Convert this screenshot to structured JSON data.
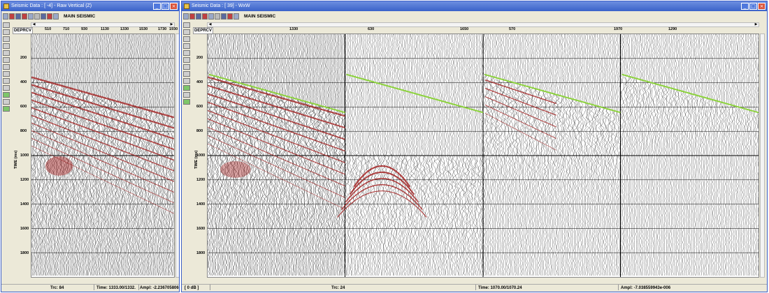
{
  "window1": {
    "title": "Seismic Data : [ -4] - Raw Vertical (Z)",
    "toolbar_label": "MAIN SEISMIC",
    "axis_corner": "DEPRCV",
    "x_ticks": [
      "510",
      "710",
      "930",
      "1130",
      "1330",
      "1530",
      "1730",
      "1930"
    ],
    "y_ticks": [
      "200",
      "400",
      "600",
      "800",
      "1000",
      "1200",
      "1400",
      "1600",
      "1800"
    ],
    "y_label": "TIME (ms)",
    "status": {
      "trc": "Trc: 84",
      "time": "Time: 1333.00/1332.",
      "ampl": "Ampl: -2.2367058061e"
    }
  },
  "window2": {
    "title": "Seismic Data : [ 39] - WxW",
    "toolbar_label": "MAIN SEISMIC",
    "axis_corner": "DEPRCV",
    "x_ticks": [
      "1330",
      "630",
      "1650",
      "570",
      "1970",
      "1290"
    ],
    "y_ticks": [
      "200",
      "400",
      "600",
      "800",
      "1000",
      "1200",
      "1400",
      "1600",
      "1800"
    ],
    "y_label": "TIME (ms)",
    "status": {
      "db": "[ 0 dB ]",
      "trc": "Trc: 24",
      "time": "Time: 1070.00/1070.24",
      "ampl": "Ampl: -7.038559943e-006"
    }
  },
  "colors": {
    "trace": "#000000",
    "wavelet": "#a01818",
    "pick": "#8cd23c",
    "titlebar": "#3a62c9"
  },
  "icons": [
    "seismic-app-icon",
    "minimize-icon",
    "maximize-icon",
    "close-icon",
    "scroll-left-arrow-icon",
    "scroll-right-arrow-icon"
  ]
}
